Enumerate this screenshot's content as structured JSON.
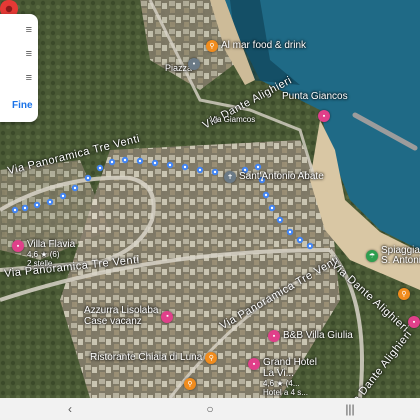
{
  "panel": {
    "fine_label": "Fine"
  },
  "labels": {
    "road_panoramica_1": "Via Panoramica Tre Venti",
    "road_panoramica_2": "Via Panoramica Tre Venti",
    "road_panoramica_3": "Via Panoramica Tre Venti",
    "road_dante": "Via Dante Alighieri",
    "road_dante_2": "Via Dante Alighieri",
    "road_dante_small": "Via Giamcos",
    "road_bottom": "Via Dante Alighieri",
    "punta": "Punta Giancos",
    "piazza": "Piazza"
  },
  "pois": {
    "almar": "Al mar food & drink",
    "antonio": "Sant'Antonio Abate",
    "spiaggia_1": "Spiaggia",
    "spiaggia_2": "S. Antonio",
    "villa_flavia": "Villa Flavia",
    "villa_flavia_sub": "4,6 ★ (6)",
    "villa_flavia_sub2": "2 stelle",
    "azzurra_1": "Azzurra Lisolaba",
    "azzurra_2": "Case vacanz",
    "bb_giulia": "B&B Villa Giulia",
    "ristorante": "Ristorante Chiaia di Luna",
    "grand_hotel_1": "Grand Hotel",
    "grand_hotel_2": "La Vi...",
    "grand_hotel_3": "4,6 ★ (4...",
    "grand_hotel_4": "Hotel a 4 s..."
  },
  "nav": {
    "back": "‹",
    "home": "○",
    "recents": "|||"
  },
  "colors": {
    "sea": "#1f6a86",
    "route": "#4285f4",
    "pin": "#e53935"
  }
}
